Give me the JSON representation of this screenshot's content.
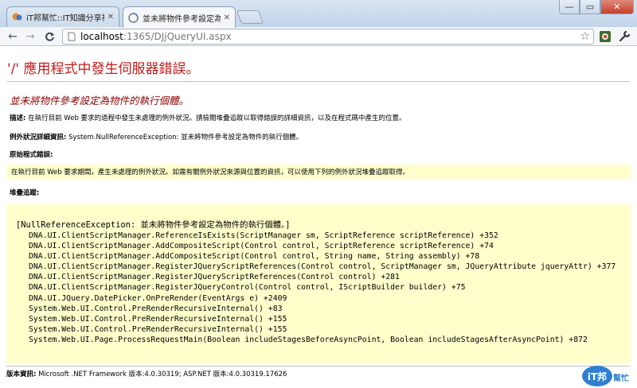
{
  "browser": {
    "tabs": [
      {
        "label": "iT邦幫忙::IT知識分享社群",
        "active": false,
        "icon": "ithome-favicon"
      },
      {
        "label": "並未將物件參考設定為物件",
        "active": true,
        "icon": "page-favicon"
      }
    ],
    "window_buttons": {
      "minimize": "—",
      "maximize": "▭",
      "close": "✕"
    },
    "url_host": "localhost",
    "url_rest": ":1365/DJjQueryUI.aspx"
  },
  "error_page": {
    "title": "'/' 應用程式中發生伺服器錯誤。",
    "subtitle": "並未將物件參考設定為物件的執行個體。",
    "description_label": "描述:",
    "description_text": "在執行目前 Web 要求的過程中發生未處理的例外狀況。請檢閱堆疊追蹤以取得錯誤的詳細資訊，以及在程式碼中產生的位置。",
    "exception_label": "例外狀況詳細資訊:",
    "exception_text": "System.NullReferenceException: 並未將物件參考設定為物件的執行個體。",
    "source_label": "原始程式錯誤:",
    "source_text": "在執行目前 Web 要求期間，產生未處理的例外狀況。如需有關例外狀況來源與位置的資訊，可以使用下列的例外狀況堆疊追蹤取得。",
    "stack_label": "堆疊追蹤:",
    "stack_header": "[NullReferenceException: 並未將物件參考設定為物件的執行個體。]",
    "stack_lines": [
      "DNA.UI.ClientScriptManager.ReferenceIsExists(ScriptManager sm, ScriptReference scriptReference) +352",
      "DNA.UI.ClientScriptManager.AddCompositeScript(Control control, ScriptReference scriptReference) +74",
      "DNA.UI.ClientScriptManager.AddCompositeScript(Control control, String name, String assembly) +78",
      "DNA.UI.ClientScriptManager.RegisterJQueryScriptReferences(Control control, ScriptManager sm, JQueryAttribute jqueryAttr) +377",
      "DNA.UI.ClientScriptManager.RegisterJQueryScriptReferences(Control control) +281",
      "DNA.UI.ClientScriptManager.RegisterJQueryControl(Control control, IScriptBuilder builder) +75",
      "DNA.UI.JQuery.DatePicker.OnPreRender(EventArgs e) +2409",
      "System.Web.UI.Control.PreRenderRecursiveInternal() +83",
      "System.Web.UI.Control.PreRenderRecursiveInternal() +155",
      "System.Web.UI.Control.PreRenderRecursiveInternal() +155",
      "System.Web.UI.Page.ProcessRequestMain(Boolean includeStagesBeforeAsyncPoint, Boolean includeStagesAfterAsyncPoint) +872"
    ],
    "version_label": "版本資訊:",
    "version_text": "Microsoft .NET Framework 版本:4.0.30319; ASP.NET 版本:4.0.30319.17626"
  },
  "watermark": {
    "brand": "iT邦",
    "sub": "幫忙"
  },
  "colors": {
    "title_red": "#c21b1b",
    "subtitle_maroon": "#8b0000",
    "highlight_yellow": "#ffffcc"
  }
}
